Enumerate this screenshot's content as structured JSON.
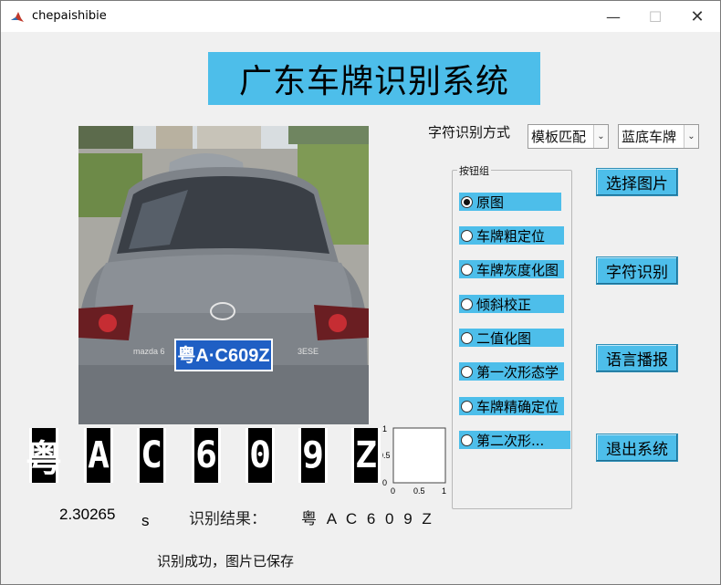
{
  "window": {
    "title": "chepaishibie",
    "minimize_glyph": "—",
    "maximize_glyph": "☐",
    "close_glyph": "✕"
  },
  "header": {
    "title": "广东车牌识别系统"
  },
  "photo": {
    "plate_text": "粤A·C609Z",
    "brand_text": "mazda 6",
    "emblem_text": "3ESE"
  },
  "segmented_chars": [
    "粤",
    "A",
    "C",
    "6",
    "0",
    "9",
    "Z"
  ],
  "mini_axes": {
    "yticks": [
      "1",
      "0.5",
      "0"
    ],
    "xticks": [
      "0",
      "0.5",
      "1"
    ]
  },
  "result": {
    "time_value": "2.30265",
    "time_unit": "s",
    "label": "识别结果：",
    "value": "粤 A C 6 0 9 Z",
    "status": "识别成功，图片已保存"
  },
  "controls": {
    "method_label": "字符识别方式",
    "method_selected": "模板匹配",
    "plate_selected": "蓝底车牌",
    "dropdown_glyph": "⌄"
  },
  "group": {
    "title": "按钮组",
    "options": [
      {
        "label": "原图",
        "selected": true
      },
      {
        "label": "车牌粗定位",
        "selected": false
      },
      {
        "label": "车牌灰度化图",
        "selected": false
      },
      {
        "label": "倾斜校正",
        "selected": false
      },
      {
        "label": "二值化图",
        "selected": false
      },
      {
        "label": "第一次形态学",
        "selected": false
      },
      {
        "label": "车牌精确定位",
        "selected": false
      },
      {
        "label": "第二次形...",
        "selected": false
      }
    ]
  },
  "buttons": {
    "select_image": "选择图片",
    "recognize": "字符识别",
    "speak": "语言播报",
    "exit": "退出系统"
  },
  "colors": {
    "accent": "#4dbeea",
    "plate_blue": "#1f5fc4"
  }
}
